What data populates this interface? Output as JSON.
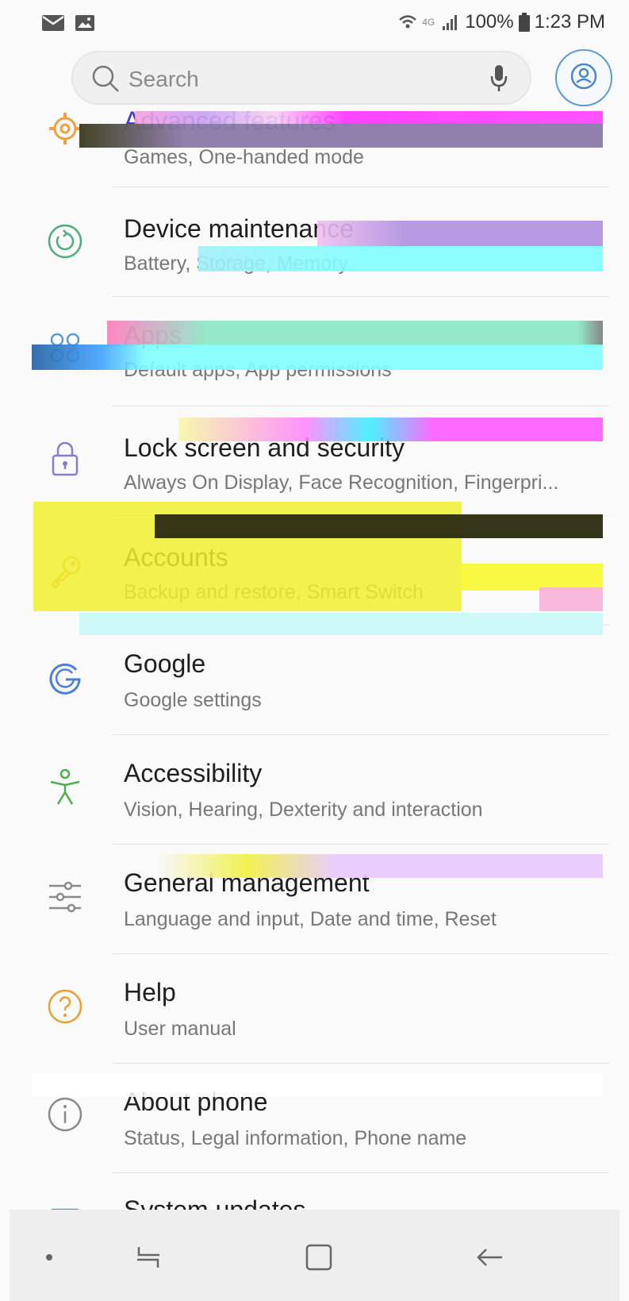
{
  "status_bar": {
    "network": "4G",
    "battery": "100%",
    "time": "1:23 PM",
    "icons": [
      "mail-icon",
      "image-icon",
      "wifi-icon",
      "signal-icon",
      "battery-icon"
    ]
  },
  "search": {
    "placeholder": "Search"
  },
  "items": [
    {
      "title": "Advanced features",
      "subtitle": "Games, One-handed mode",
      "icon": "gear-plus-icon",
      "icon_color": "#f0a040"
    },
    {
      "title": "Device maintenance",
      "subtitle": "Battery, Storage, Memory",
      "icon": "refresh-circle-icon",
      "icon_color": "#4cae7a"
    },
    {
      "title": "Apps",
      "subtitle": "Default apps, App permissions",
      "icon": "apps-icon",
      "icon_color": "#5b9bd5"
    },
    {
      "title": "Lock screen and security",
      "subtitle": "Always On Display, Face Recognition, Fingerpri...",
      "icon": "lock-icon",
      "icon_color": "#8a7ad0"
    },
    {
      "title": "Accounts",
      "subtitle": "Backup and restore, Smart Switch",
      "icon": "key-icon",
      "icon_color": "#e8a030"
    },
    {
      "title": "Google",
      "subtitle": "Google settings",
      "icon": "google-icon",
      "icon_color": "#4a7fd8"
    },
    {
      "title": "Accessibility",
      "subtitle": "Vision, Hearing, Dexterity and interaction",
      "icon": "accessibility-icon",
      "icon_color": "#4cae4c"
    },
    {
      "title": "General management",
      "subtitle": "Language and input, Date and time, Reset",
      "icon": "sliders-icon",
      "icon_color": "#8a8a8a"
    },
    {
      "title": "Help",
      "subtitle": "User manual",
      "icon": "help-icon",
      "icon_color": "#e8a030"
    },
    {
      "title": "About phone",
      "subtitle": "Status, Legal information, Phone name",
      "icon": "info-icon",
      "icon_color": "#8a8a8a"
    },
    {
      "title": "System updates",
      "subtitle": "",
      "icon": "system-update-icon",
      "icon_color": "#5b9bd5"
    }
  ],
  "nav": {
    "buttons": [
      "dot-icon",
      "recent-apps-icon",
      "home-icon",
      "back-icon"
    ]
  },
  "colors": {
    "background": "#fafafa",
    "accent": "#5b9bd5",
    "nav_background": "#eeeeee"
  }
}
